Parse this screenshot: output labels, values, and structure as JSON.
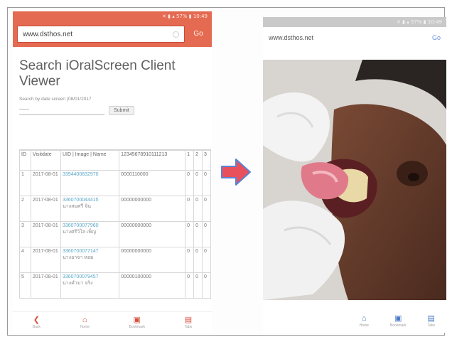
{
  "left_phone": {
    "status_text": "✕ ▮ ▴ 57% ▮ 10:49",
    "url": "www.dsthos.net",
    "go_label": "Go",
    "page_title": "Search iOralScreen Client Viewer",
    "search_label": "Search by date screen (08/01/2017",
    "search_placeholder": "——",
    "submit_label": "Submit",
    "table_headers": [
      "ID",
      "Visitdate",
      "UID | Image | Name",
      "12345678910111213",
      "1",
      "2",
      "3"
    ],
    "rows": [
      {
        "id": "1",
        "date": "2017-08-01",
        "uid": "3394400832970",
        "name": "",
        "numbers": "0000110000",
        "s1": "0",
        "s2": "0",
        "s3": "0"
      },
      {
        "id": "2",
        "date": "2017-08-01",
        "uid": "3360700044415",
        "name": "นางสมศรี จิน",
        "numbers": "00000000000",
        "s1": "0",
        "s2": "0",
        "s3": "0"
      },
      {
        "id": "3",
        "date": "2017-08-01",
        "uid": "3360700077960",
        "name": "นางศรีวิไล เพ็ญ",
        "numbers": "00000000000",
        "s1": "0",
        "s2": "0",
        "s3": "0"
      },
      {
        "id": "4",
        "date": "2017-08-01",
        "uid": "3360700077147",
        "name": "นางอาจา หอม",
        "numbers": "00000000000",
        "s1": "0",
        "s2": "0",
        "s3": "0"
      },
      {
        "id": "5",
        "date": "2017-08-01",
        "uid": "3360700079457",
        "name": "นางคำมา จริง",
        "numbers": "00000100000",
        "s1": "0",
        "s2": "0",
        "s3": "0"
      }
    ],
    "nav": [
      "Back",
      "Home",
      "Bookmark",
      "Tabs"
    ]
  },
  "right_phone": {
    "status_text": "✕ ▮ ▴ 57% ▮ 10:49",
    "url": "www.dsthos.net",
    "go_label": "Go",
    "nav": [
      "Home",
      "Bookmark",
      "Tabs"
    ]
  },
  "colors": {
    "accent": "#e46a52",
    "link": "#59a7c9",
    "arrow": "#e8505b",
    "arrow_outline": "#5b83d6"
  }
}
